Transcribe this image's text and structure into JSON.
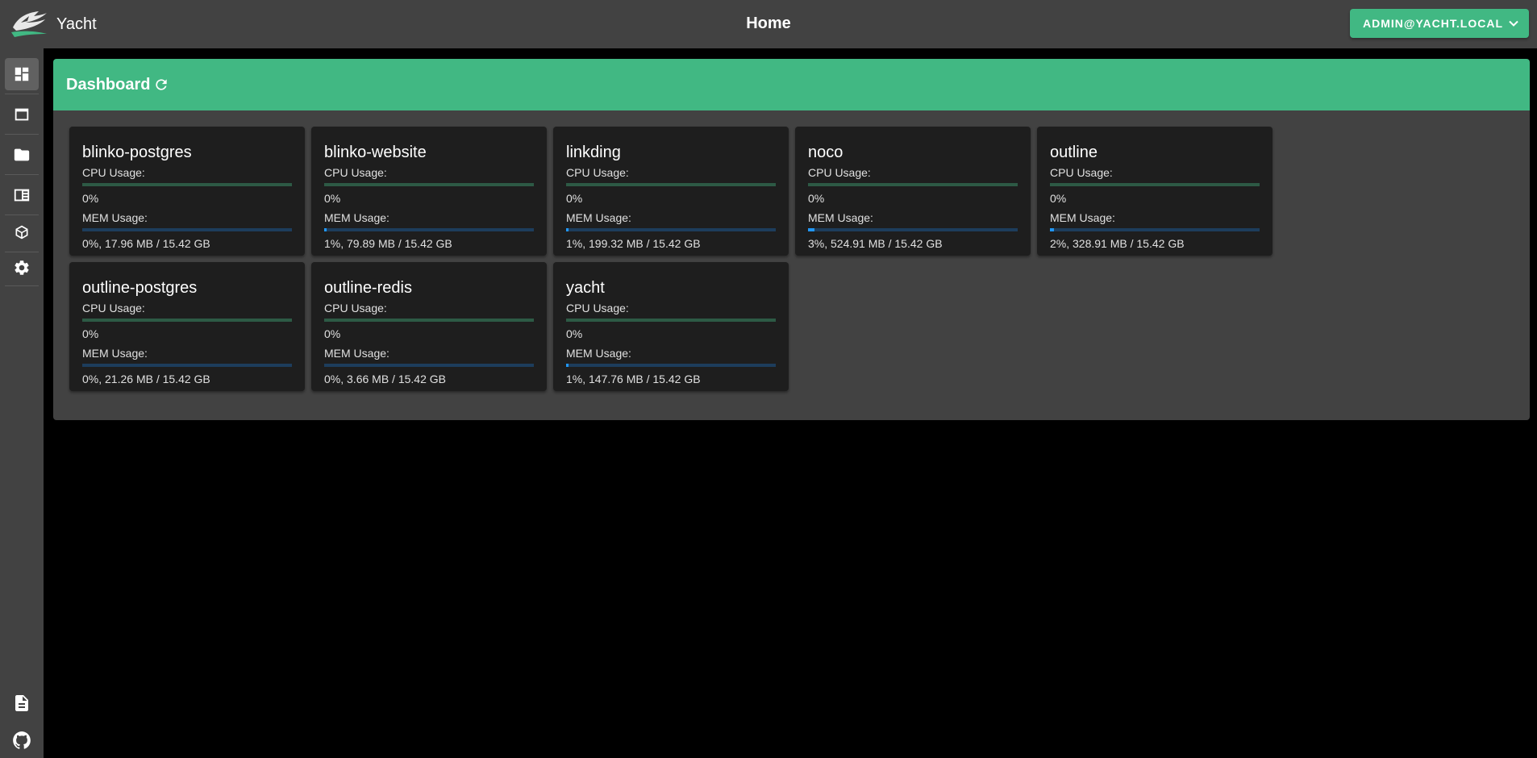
{
  "app": {
    "name": "Yacht",
    "page_title": "Home"
  },
  "user": {
    "label": "ADMIN@YACHT.LOCAL"
  },
  "colors": {
    "accent": "#41b883",
    "surface": "#424242",
    "card": "#1e1e1e",
    "mem_bar": "#2196f3"
  },
  "sidebar": {
    "items": [
      {
        "icon": "dashboard-icon",
        "active": true
      },
      {
        "icon": "window-icon",
        "active": false
      },
      {
        "icon": "folder-icon",
        "active": false
      },
      {
        "icon": "view-list-icon",
        "active": false
      },
      {
        "icon": "cube-icon",
        "active": false
      },
      {
        "icon": "gear-icon",
        "active": false
      }
    ],
    "bottom": [
      {
        "icon": "document-icon"
      },
      {
        "icon": "github-icon"
      }
    ]
  },
  "dashboard": {
    "title": "Dashboard",
    "cpu_label": "CPU Usage:",
    "mem_label": "MEM Usage:",
    "apps": [
      {
        "name": "blinko-postgres",
        "cpu": "0%",
        "cpu_pct": 0,
        "mem": "0%, 17.96 MB / 15.42 GB",
        "mem_pct": 0
      },
      {
        "name": "blinko-website",
        "cpu": "0%",
        "cpu_pct": 0,
        "mem": "1%, 79.89 MB / 15.42 GB",
        "mem_pct": 1
      },
      {
        "name": "linkding",
        "cpu": "0%",
        "cpu_pct": 0,
        "mem": "1%, 199.32 MB / 15.42 GB",
        "mem_pct": 1
      },
      {
        "name": "noco",
        "cpu": "0%",
        "cpu_pct": 0,
        "mem": "3%, 524.91 MB / 15.42 GB",
        "mem_pct": 3
      },
      {
        "name": "outline",
        "cpu": "0%",
        "cpu_pct": 0,
        "mem": "2%, 328.91 MB / 15.42 GB",
        "mem_pct": 2
      },
      {
        "name": "outline-postgres",
        "cpu": "0%",
        "cpu_pct": 0,
        "mem": "0%, 21.26 MB / 15.42 GB",
        "mem_pct": 0
      },
      {
        "name": "outline-redis",
        "cpu": "0%",
        "cpu_pct": 0,
        "mem": "0%, 3.66 MB / 15.42 GB",
        "mem_pct": 0
      },
      {
        "name": "yacht",
        "cpu": "0%",
        "cpu_pct": 0,
        "mem": "1%, 147.76 MB / 15.42 GB",
        "mem_pct": 1
      }
    ]
  }
}
